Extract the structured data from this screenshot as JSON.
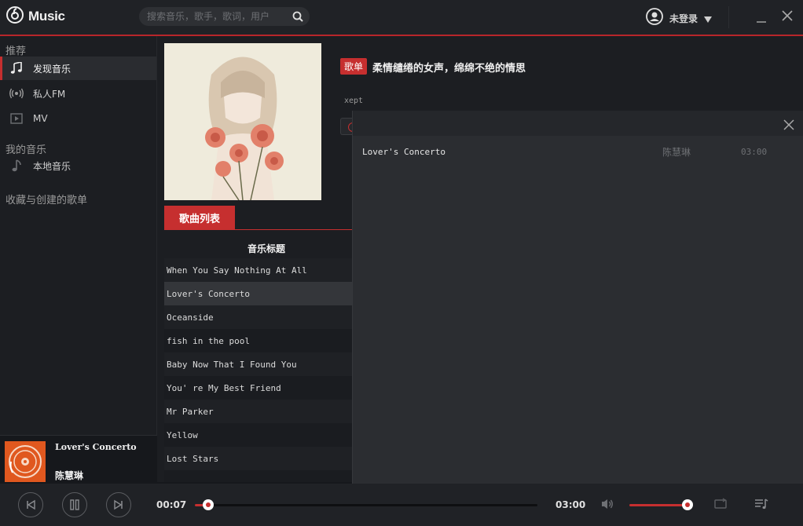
{
  "app": {
    "title": "Music"
  },
  "search": {
    "placeholder": "搜索音乐，歌手，歌词，用户"
  },
  "user": {
    "label": "未登录"
  },
  "sidebar": {
    "sections": [
      {
        "title": "推荐"
      },
      {
        "title": "我的音乐"
      },
      {
        "title": "收藏与创建的歌单"
      }
    ],
    "items": [
      {
        "label": "发现音乐",
        "icon": "music-note-icon",
        "active": true
      },
      {
        "label": "私人FM",
        "icon": "radio-icon",
        "active": false
      },
      {
        "label": "MV",
        "icon": "video-icon",
        "active": false
      },
      {
        "label": "本地音乐",
        "icon": "music-note-icon",
        "active": false
      }
    ]
  },
  "now_playing": {
    "title": "Lover's Concerto",
    "artist": "陈慧琳"
  },
  "playlist": {
    "badge": "歌单",
    "title": "柔情缱绻的女声，绵绵不绝的情思",
    "creator": "xept",
    "tab": "歌曲列表",
    "column_header": "音乐标题",
    "songs": [
      "When You Say Nothing At All",
      "Lover's Concerto",
      "Oceanside",
      "fish in the pool",
      "Baby Now That I Found You",
      "You' re My Best Friend",
      "Mr Parker",
      "Yellow",
      "Lost Stars"
    ],
    "selected_index": 1
  },
  "queue": {
    "items": [
      {
        "title": "Lover's Concerto",
        "artist": "陈慧琳",
        "duration": "03:00"
      }
    ]
  },
  "player": {
    "current_time": "00:07",
    "total_time": "03:00",
    "progress": 0.039,
    "volume": 1.0
  },
  "colors": {
    "accent": "#c62f2f",
    "background": "#1c1e22",
    "topbar": "#202226"
  }
}
